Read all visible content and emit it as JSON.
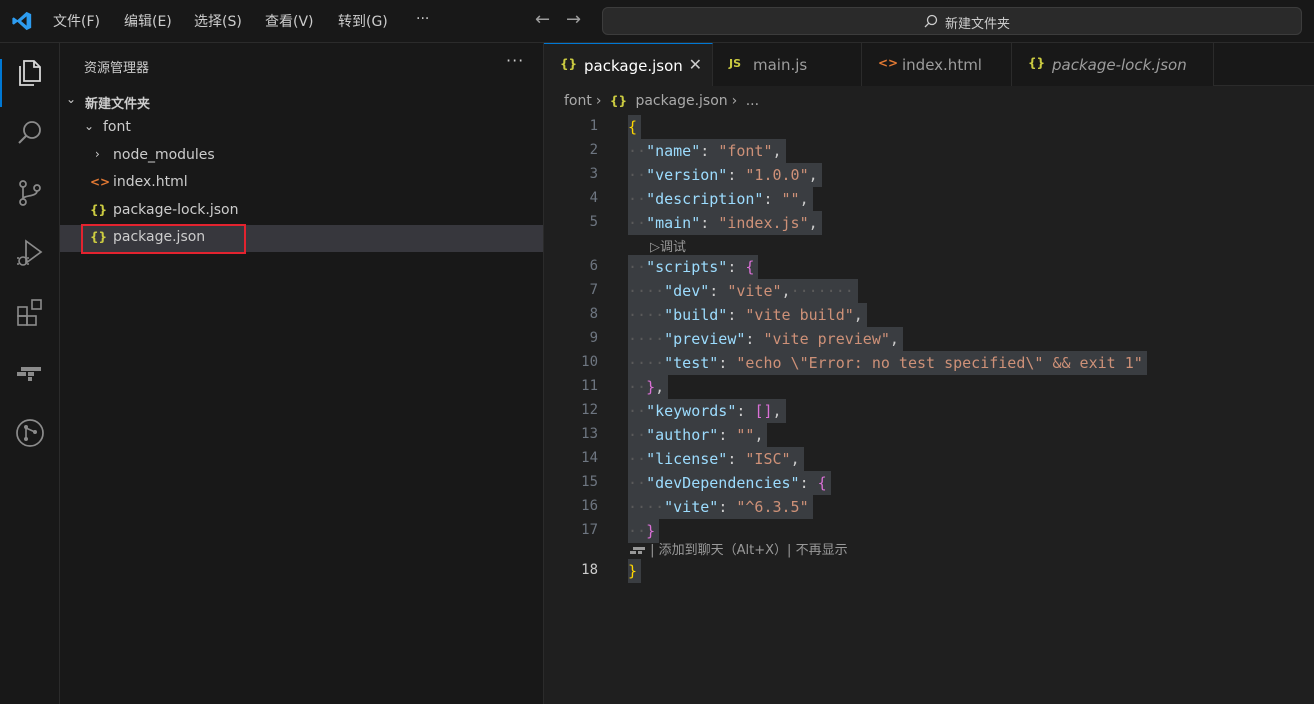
{
  "titlebar": {
    "menus": [
      "文件(F)",
      "编辑(E)",
      "选择(S)",
      "查看(V)",
      "转到(G)",
      "···"
    ],
    "search_text": "新建文件夹",
    "back_icon": "arrow-left-icon",
    "forward_icon": "arrow-right-icon"
  },
  "activity_bar": {
    "items": [
      "explorer-icon",
      "search-icon",
      "source-control-icon",
      "run-debug-icon",
      "extensions-icon",
      "chat-icon",
      "git-graph-icon"
    ],
    "accent": "#0078d4"
  },
  "sidebar": {
    "title": "资源管理器",
    "more": "···",
    "root": "新建文件夹",
    "folder": "font",
    "items": [
      {
        "label": "node_modules",
        "type": "folder"
      },
      {
        "label": "index.html",
        "type": "html"
      },
      {
        "label": "package-lock.json",
        "type": "json"
      },
      {
        "label": "package.json",
        "type": "json",
        "selected": true
      }
    ]
  },
  "tabs": [
    {
      "label": "package.json",
      "icon": "{}",
      "active": true,
      "close": "✕"
    },
    {
      "label": "main.js",
      "icon": "JS"
    },
    {
      "label": "index.html",
      "icon": "<>"
    },
    {
      "label": "package-lock.json",
      "icon": "{}",
      "italic": true
    }
  ],
  "breadcrumb": {
    "folder": "font",
    "file": "package.json",
    "more": "..."
  },
  "editor": {
    "codelens_debug": "▷调试",
    "hint": "| 添加到聊天（Alt+X）| 不再显示",
    "line_numbers": [
      "1",
      "2",
      "3",
      "4",
      "5",
      "6",
      "7",
      "8",
      "9",
      "10",
      "11",
      "12",
      "13",
      "14",
      "15",
      "16",
      "17",
      "18"
    ],
    "lines": [
      "{",
      "\"name\": \"font\",",
      "\"version\": \"1.0.0\",",
      "\"description\": \"\",",
      "\"main\": \"index.js\",",
      "\"scripts\": {",
      "\"dev\": \"vite\",",
      "\"build\": \"vite build\",",
      "\"preview\": \"vite preview\",",
      "\"test\": \"echo \\\"Error: no test specified\\\" && exit 1\"",
      "},",
      "\"keywords\": [],",
      "\"author\": \"\",",
      "\"license\": \"ISC\",",
      "\"devDependencies\": {",
      "\"vite\": \"^6.3.5\"",
      "}",
      "}"
    ]
  }
}
